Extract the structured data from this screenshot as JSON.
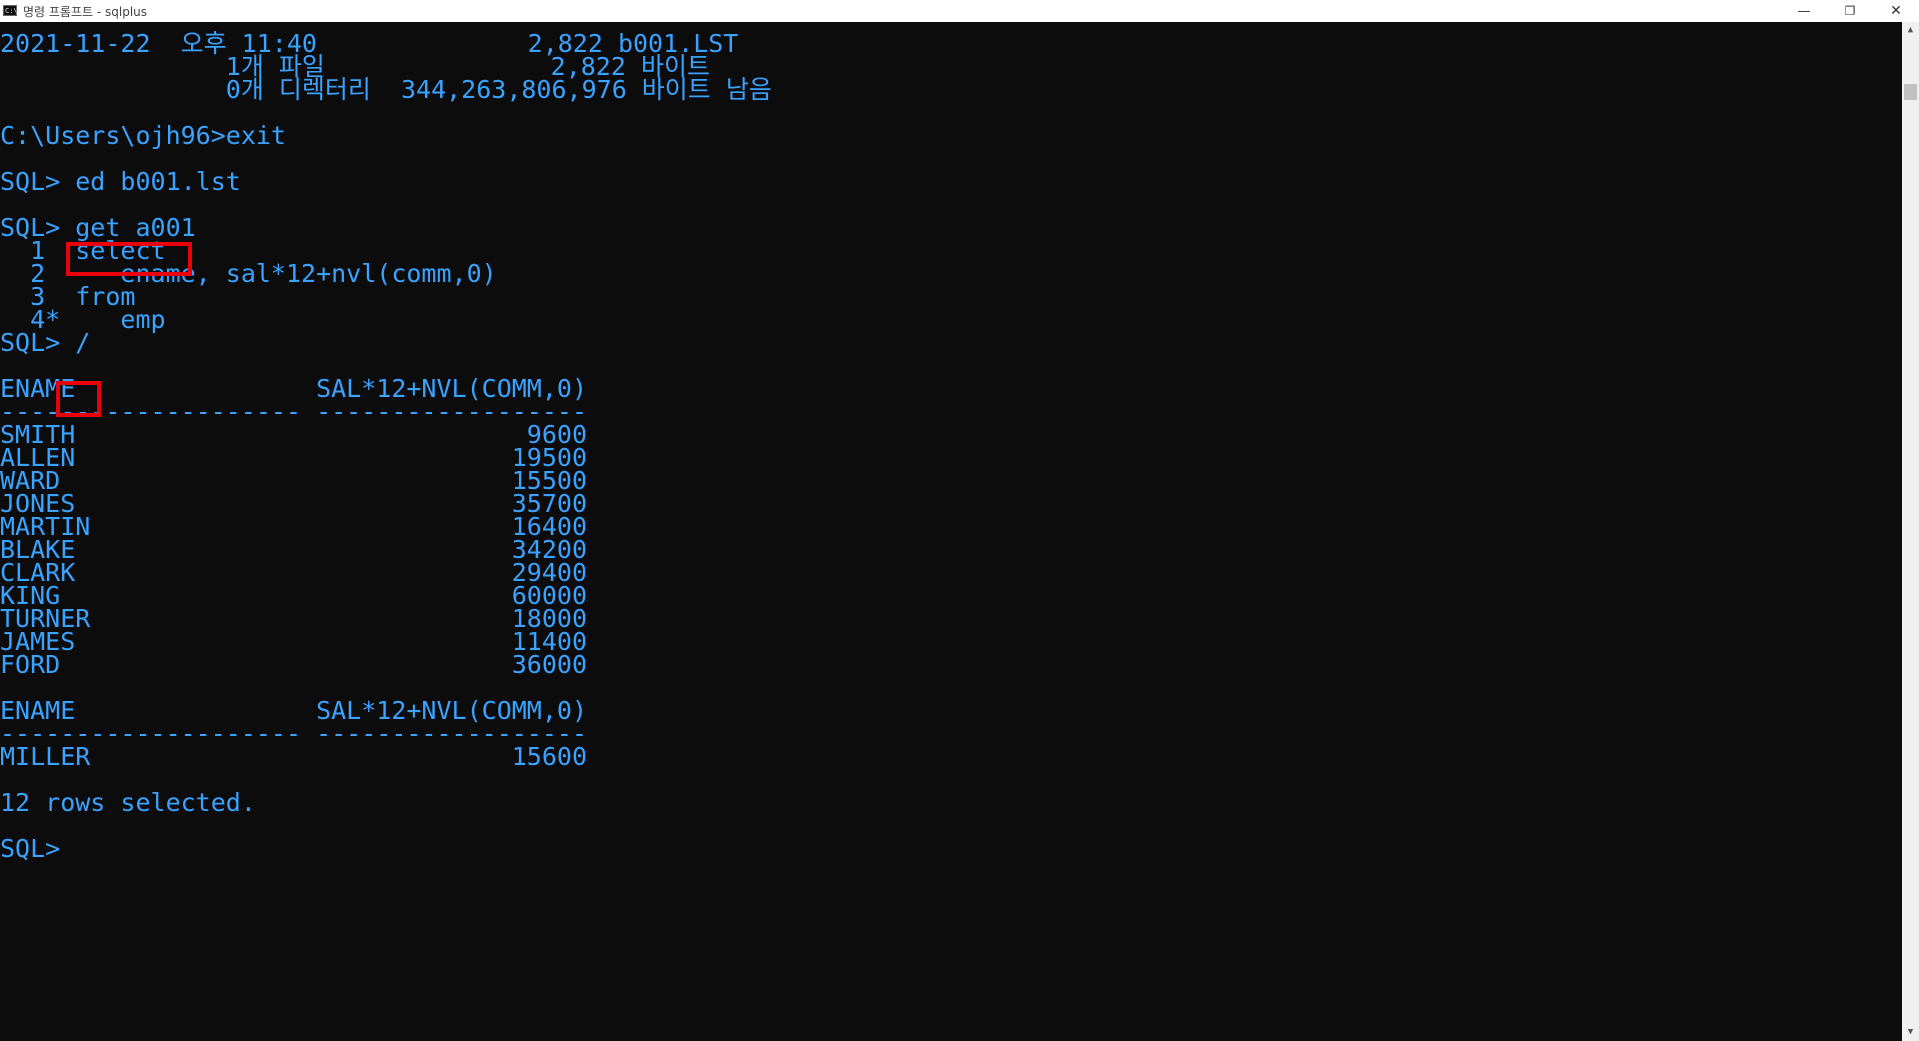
{
  "window": {
    "title": "명령 프롬프트 - sqlplus",
    "icon": "C:\\",
    "minimize_glyph": "—",
    "maximize_glyph": "❐",
    "close_glyph": "✕"
  },
  "scrollbar": {
    "up": "▲",
    "down": "▼"
  },
  "console": {
    "lines": [
      "2021-11-22  오후 11:40              2,822 b001.LST",
      "               1개 파일               2,822 바이트",
      "               0개 디렉터리  344,263,806,976 바이트 남음",
      "",
      "C:\\Users\\ojh96>exit",
      "",
      "SQL> ed b001.lst",
      "",
      "SQL> get a001",
      "  1  select",
      "  2     ename, sal*12+nvl(comm,0)",
      "  3  from",
      "  4*    emp",
      "SQL> /",
      "",
      "ENAME                SAL*12+NVL(COMM,0)",
      "-------------------- ------------------",
      "SMITH                              9600",
      "ALLEN                             19500",
      "WARD                              15500",
      "JONES                             35700",
      "MARTIN                            16400",
      "BLAKE                             34200",
      "CLARK                             29400",
      "KING                              60000",
      "TURNER                            18000",
      "JAMES                             11400",
      "FORD                              36000",
      "",
      "ENAME                SAL*12+NVL(COMM,0)",
      "-------------------- ------------------",
      "MILLER                            15600",
      "",
      "12 rows selected.",
      "",
      "SQL>"
    ],
    "text_color": "#3aa2ff",
    "background": "#0c0c0c",
    "highlight_color": "#e8000b"
  }
}
